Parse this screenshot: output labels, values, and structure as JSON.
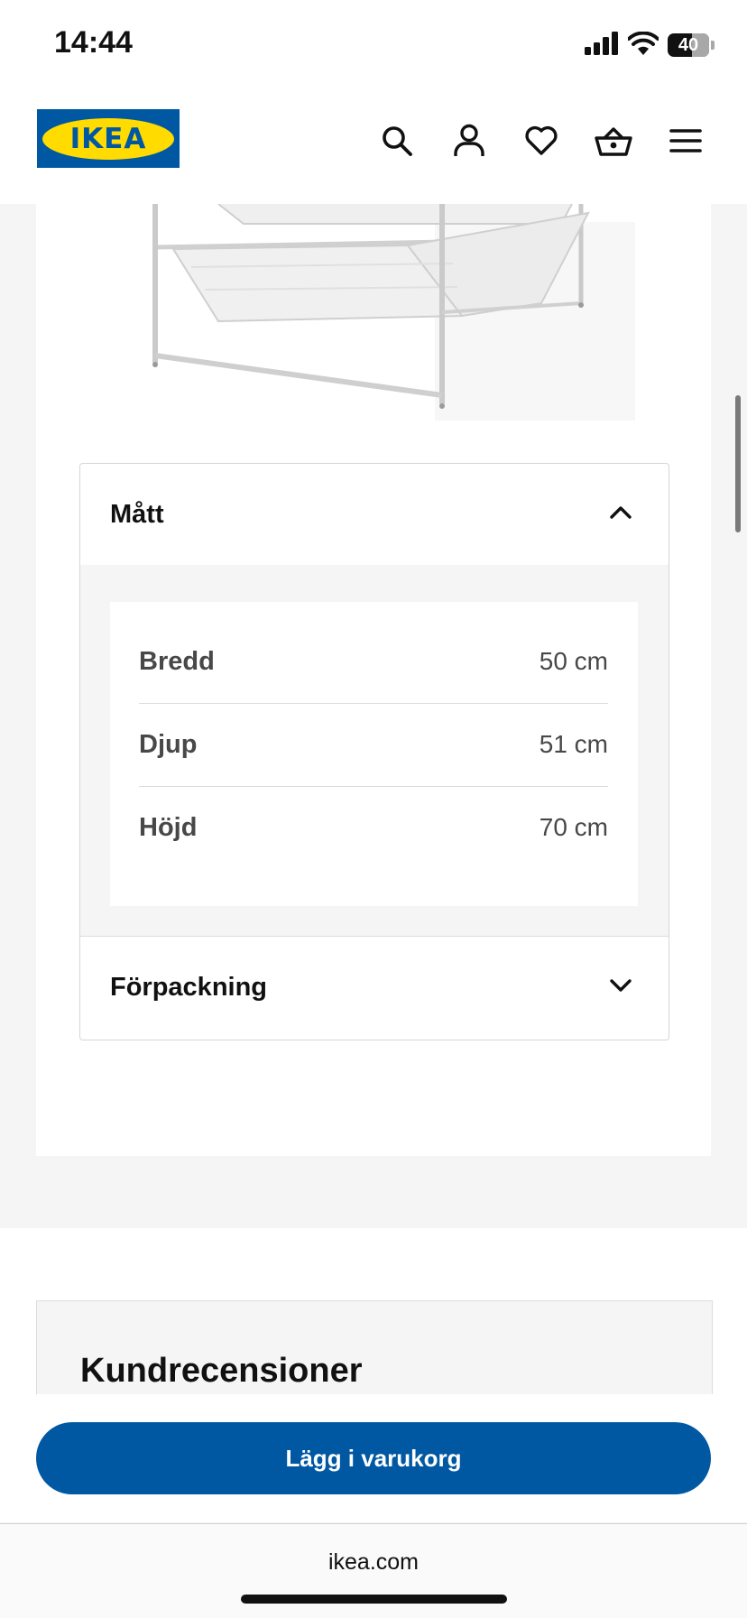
{
  "status_bar": {
    "time": "14:44",
    "battery": "40",
    "icons": [
      "cellular-signal-icon",
      "wifi-icon",
      "battery-icon"
    ]
  },
  "header": {
    "logo_text": "IKEA",
    "icons": [
      "search-icon",
      "account-icon",
      "heart-icon",
      "basket-icon",
      "menu-icon"
    ],
    "brand_blue": "#0058a3",
    "brand_yellow": "#ffdb00"
  },
  "product": {
    "image": "wire-basket-drawer-frame-image"
  },
  "measurements": {
    "title": "Mått",
    "expanded": true,
    "rows": [
      {
        "label": "Bredd",
        "value": "50 cm"
      },
      {
        "label": "Djup",
        "value": "51 cm"
      },
      {
        "label": "Höjd",
        "value": "70 cm"
      }
    ]
  },
  "packaging": {
    "title": "Förpackning",
    "expanded": false
  },
  "reviews": {
    "title": "Kundrecensioner"
  },
  "cart": {
    "button_label": "Lägg i varukorg"
  },
  "browser": {
    "url": "ikea.com"
  }
}
